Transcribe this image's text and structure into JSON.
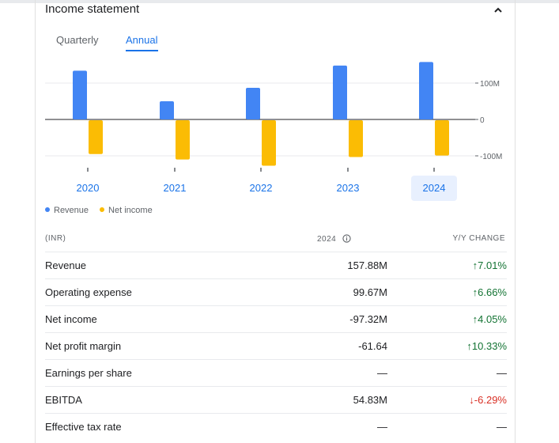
{
  "card": {
    "title": "Income statement",
    "tabs": [
      {
        "label": "Quarterly",
        "active": false
      },
      {
        "label": "Annual",
        "active": true
      }
    ]
  },
  "chart_data": {
    "type": "bar",
    "categories": [
      "2020",
      "2021",
      "2022",
      "2023",
      "2024"
    ],
    "selected_category": "2024",
    "series": [
      {
        "name": "Revenue",
        "color": "#4285f4",
        "values": [
          134,
          50,
          87,
          148,
          158
        ]
      },
      {
        "name": "Net income",
        "color": "#fbbc04",
        "values": [
          -93,
          -108,
          -125,
          -101,
          -97
        ]
      }
    ],
    "y_ticks": [
      "100M",
      "0",
      "-100M"
    ],
    "ylim": [
      -160,
      160
    ],
    "legend_position": "bottom-left"
  },
  "table": {
    "headers": {
      "label": "(INR)",
      "value": "2024",
      "change": "Y/Y CHANGE"
    },
    "rows": [
      {
        "label": "Revenue",
        "value": "157.88M",
        "change": "7.01%",
        "dir": "up"
      },
      {
        "label": "Operating expense",
        "value": "99.67M",
        "change": "6.66%",
        "dir": "up"
      },
      {
        "label": "Net income",
        "value": "-97.32M",
        "change": "4.05%",
        "dir": "up"
      },
      {
        "label": "Net profit margin",
        "value": "-61.64",
        "change": "10.33%",
        "dir": "up"
      },
      {
        "label": "Earnings per share",
        "value": "—",
        "change": "—",
        "dir": "none"
      },
      {
        "label": "EBITDA",
        "value": "54.83M",
        "change": "-6.29%",
        "dir": "down"
      },
      {
        "label": "Effective tax rate",
        "value": "—",
        "change": "—",
        "dir": "none"
      }
    ]
  }
}
